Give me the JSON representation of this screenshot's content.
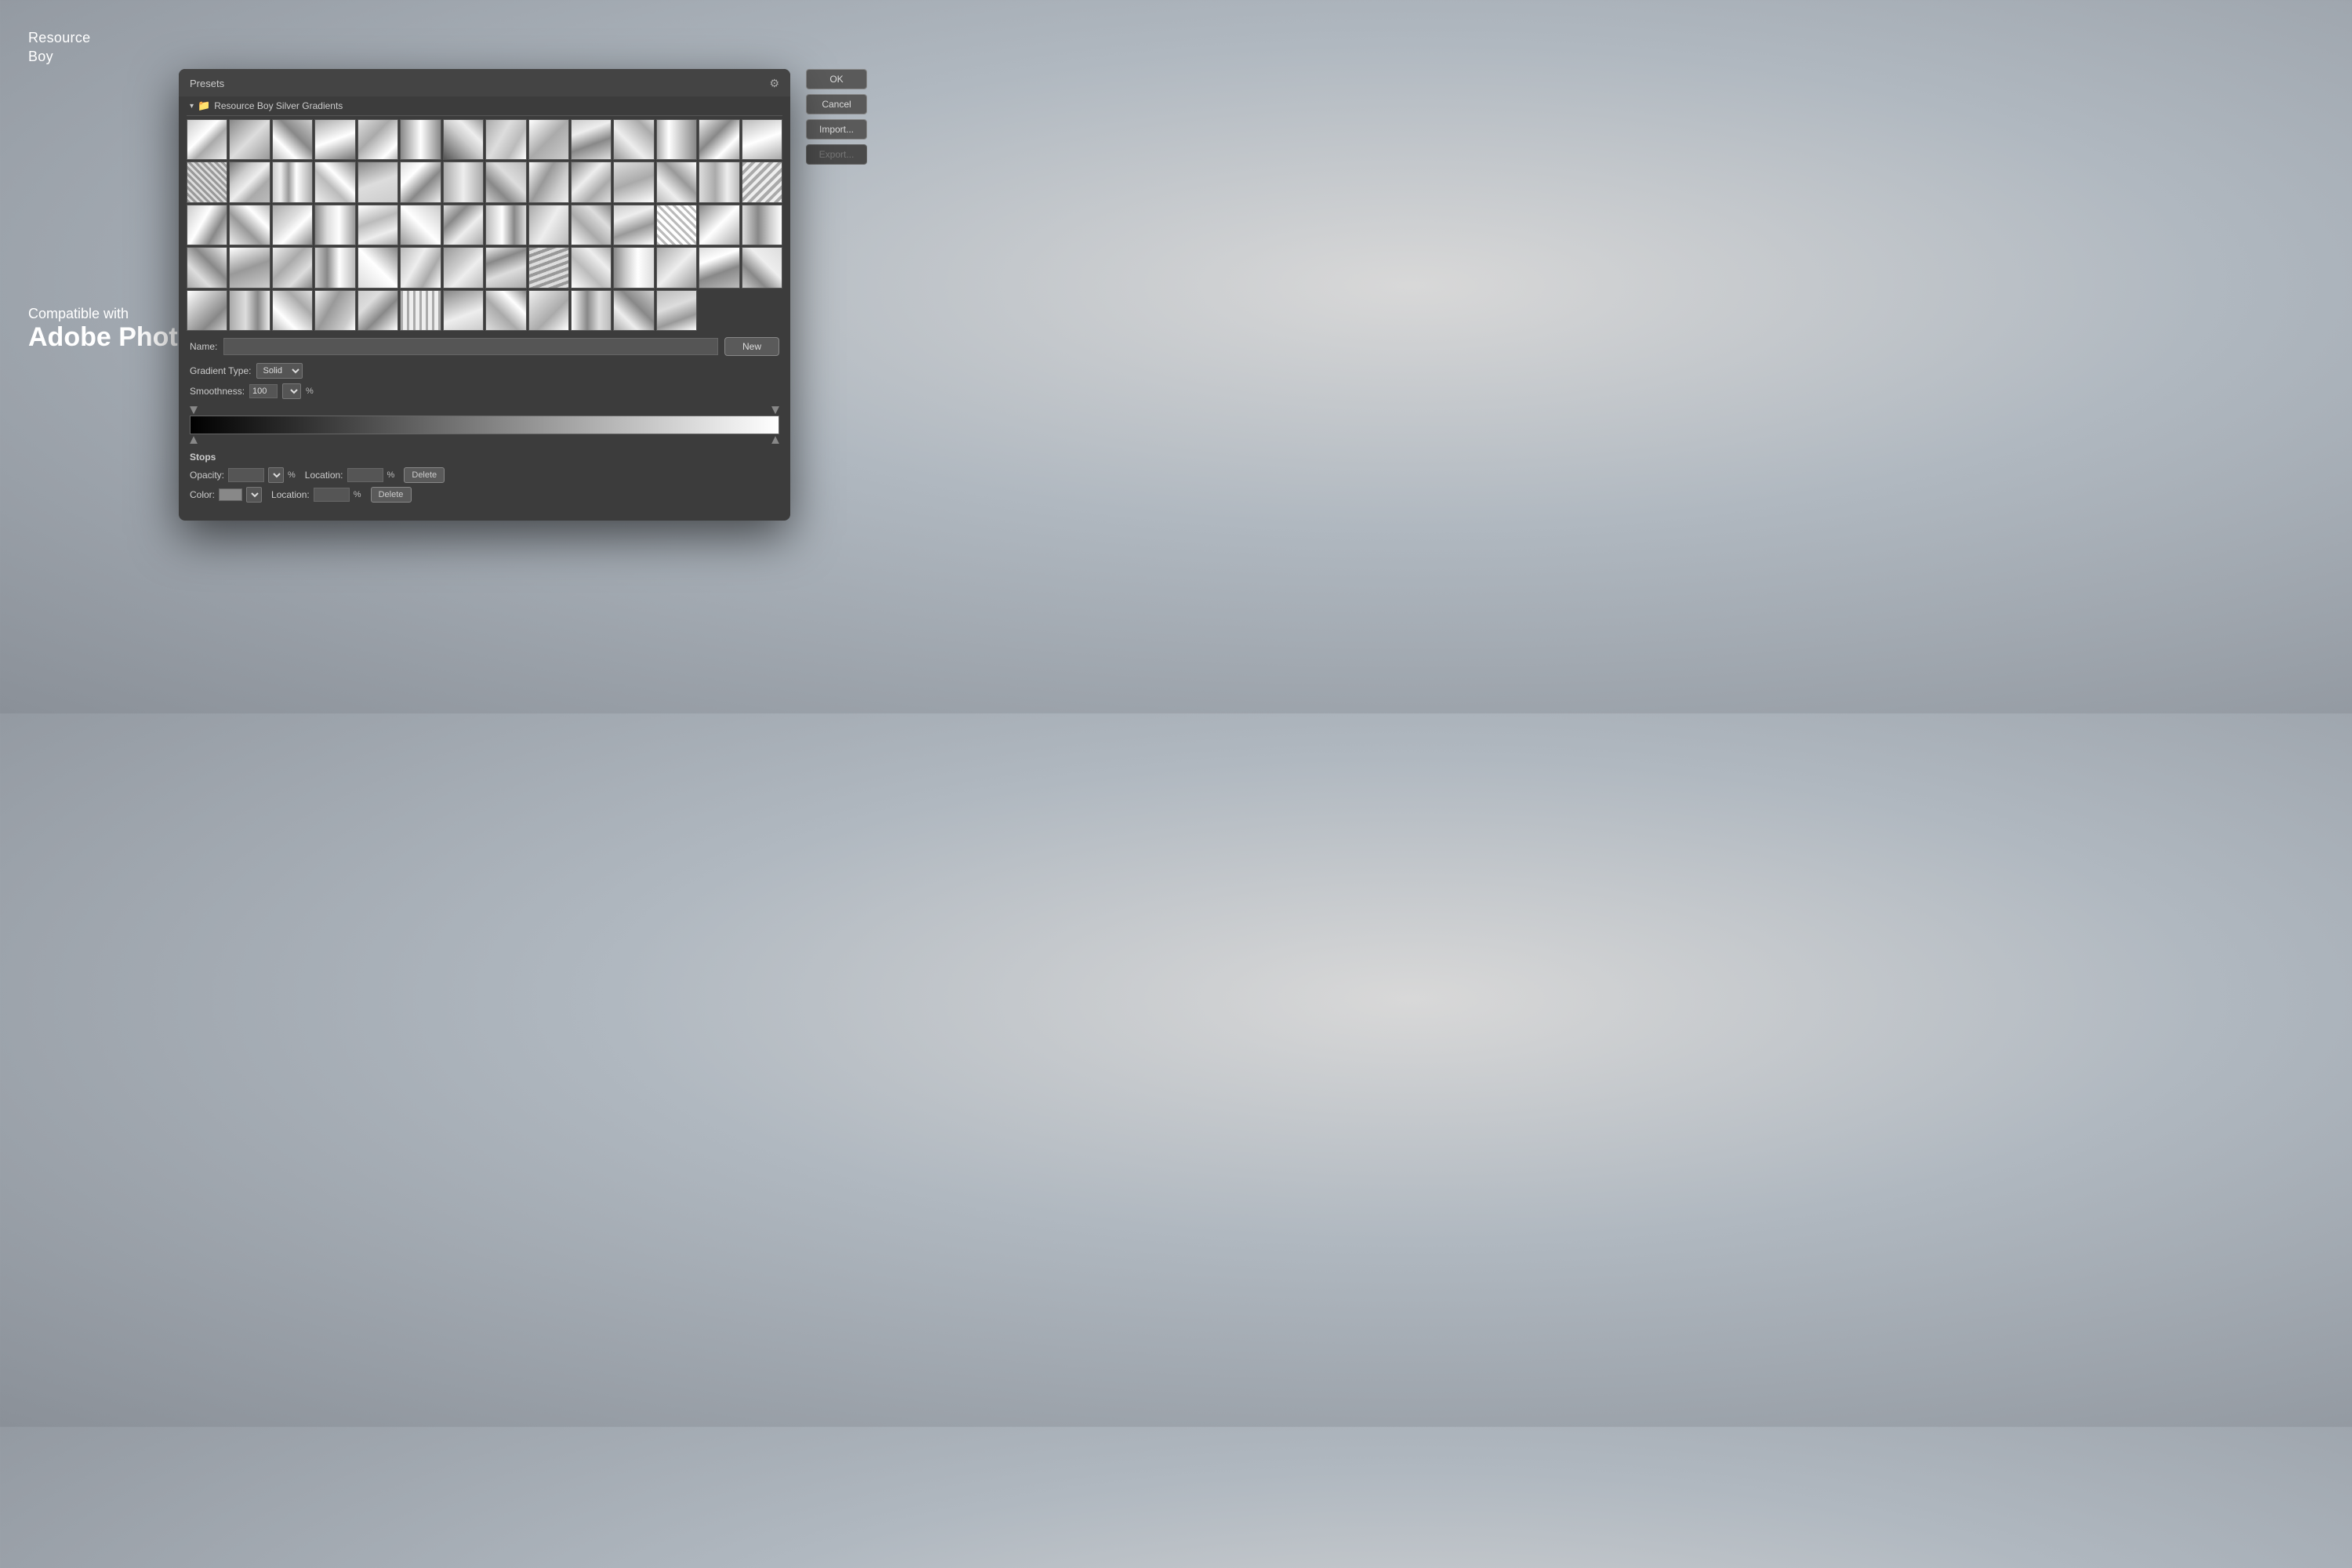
{
  "watermark": {
    "line1": "Resource",
    "line2": "Boy"
  },
  "compatible": {
    "top": "Compatible with",
    "bottom": "Adobe Photoshop"
  },
  "dialog": {
    "title": "Presets",
    "folder_name": "Resource Boy Silver Gradients",
    "buttons": {
      "ok": "OK",
      "cancel": "Cancel",
      "import": "Import...",
      "export": "Export...",
      "new": "New"
    },
    "name_label": "Name:",
    "gradient_type_label": "Gradient Type:",
    "gradient_type_value": "Solid",
    "smoothness_label": "Smoothness:",
    "smoothness_value": "100",
    "smoothness_unit": "%",
    "stops_section": "Stops",
    "opacity_label": "Opacity:",
    "opacity_unit": "%",
    "color_label": "Color:",
    "location_label": "Location:",
    "location_unit": "%",
    "delete_label": "Delete"
  }
}
